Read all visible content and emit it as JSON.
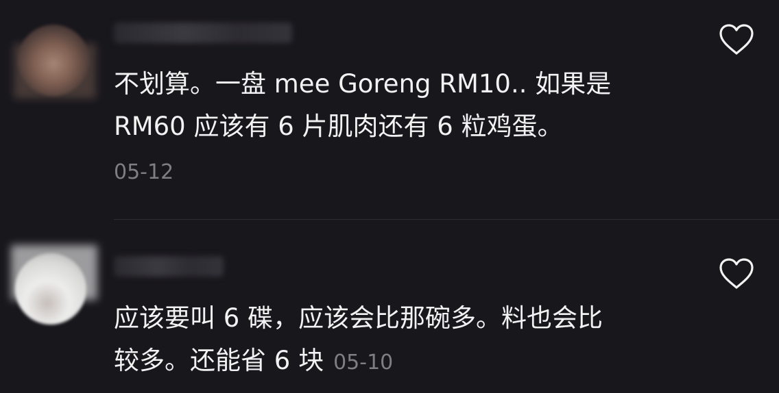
{
  "comments": [
    {
      "username": "",
      "text_line1": "不划算。一盘 mee Goreng RM10.. 如果是",
      "text_line2": "RM60 应该有 6 片肌肉还有 6 粒鸡蛋。",
      "date": "05-12",
      "like_icon": "heart-outline-icon"
    },
    {
      "username": "",
      "text_line1": "应该要叫 6 碟，应该会比那碗多。料也会比",
      "text_line2": "较多。还能省 6 块",
      "date": "05-10",
      "like_icon": "heart-outline-icon"
    }
  ],
  "colors": {
    "background": "#18171c",
    "text": "#f2f2f2",
    "muted": "#7f7e85"
  }
}
